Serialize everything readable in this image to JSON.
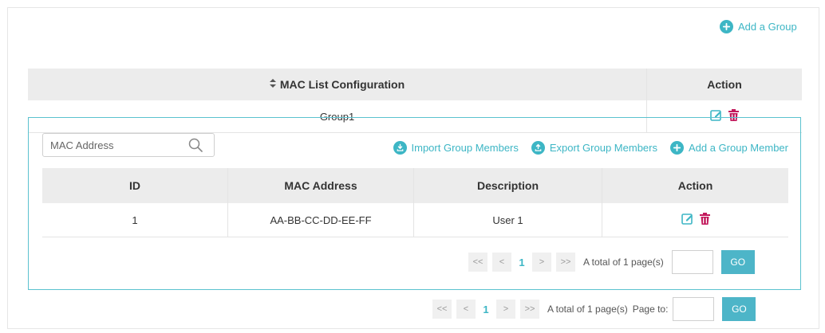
{
  "toolbar": {
    "add_group": "Add a Group"
  },
  "outer_table": {
    "col_config": "MAC List Configuration",
    "col_action": "Action",
    "group_name": "Group1"
  },
  "group_panel": {
    "search_placeholder": "MAC Address",
    "import_label": "Import Group Members",
    "export_label": "Export Group Members",
    "add_member_label": "Add a Group Member",
    "columns": [
      "ID",
      "MAC Address",
      "Description",
      "Action"
    ],
    "rows": [
      {
        "id": "1",
        "mac": "AA-BB-CC-DD-EE-FF",
        "description": "User 1"
      }
    ],
    "pager": {
      "first": "<<",
      "prev": "<",
      "page": "1",
      "next": ">",
      "last": ">>",
      "total": "A total of 1 page(s)",
      "go": "GO"
    }
  },
  "outer_pager": {
    "first": "<<",
    "prev": "<",
    "page": "1",
    "next": ">",
    "last": ">>",
    "total": "A total of 1 page(s)",
    "page_to": "Page to:",
    "go": "GO"
  },
  "colors": {
    "accent": "#3db6c5",
    "danger": "#c2185b",
    "header_bg": "#ececec"
  },
  "icons": {
    "add": "plus-circle-icon",
    "import": "download-circle-icon",
    "export": "upload-circle-icon",
    "edit": "edit-icon",
    "delete": "trash-icon",
    "search": "search-icon",
    "sort": "sort-icon"
  }
}
